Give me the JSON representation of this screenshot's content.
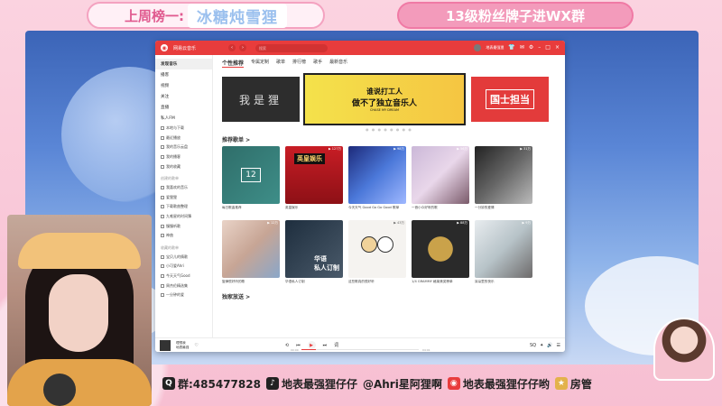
{
  "overlay": {
    "weekly_label": "上周榜一:",
    "weekly_name": "冰糖炖雪狸",
    "fan_group": "13级粉丝牌子进WX群",
    "qq_group": "群:485477828",
    "douyin": "地表最强狸仔仔",
    "weibo": "@Ahri星阿狸啊",
    "netease": "地表最强狸仔仔哟",
    "manager": "房管"
  },
  "app": {
    "title": "网易云音乐",
    "search_placeholder": "搜索",
    "user": "地表最强狸",
    "sidebar": {
      "items": [
        "发现音乐",
        "播客",
        "视频",
        "关注",
        "直播",
        "私人FM"
      ],
      "my_group": [
        "本地与下载",
        "最近播放",
        "我的音乐云盘",
        "我的播客",
        "我的收藏"
      ],
      "created_label": "创建的歌单",
      "playlists": [
        "我喜欢的音乐",
        "爱狸狸",
        "下载歌曲整理",
        "九唯星的时间簿",
        "慢慢听歌",
        "神曲"
      ],
      "collected_label": "收藏的歌单",
      "collected": [
        "宝贝儿的情歌",
        "小可爱Ahri",
        "今天天气Good",
        "周杰伦精选集",
        "一分钟的爱"
      ]
    },
    "tabs": [
      "个性推荐",
      "专属定制",
      "歌单",
      "排行榜",
      "歌手",
      "最新音乐"
    ],
    "banners": {
      "left": "我是狸",
      "mid_line1": "谁说打工人",
      "mid_line2": "做不了独立音乐人",
      "mid_line3": "CHASE MY DREAM",
      "right": "国士担当"
    },
    "recommended_title": "推荐歌单 >",
    "exclusive_title": "独家放送 >",
    "cards": [
      {
        "caption": "每日歌曲推荐",
        "count": ""
      },
      {
        "caption": "英皇娱乐",
        "count": "▶ 127万"
      },
      {
        "caption": "今天天气 Good Go Go Good 歌单",
        "count": "▶ 98万"
      },
      {
        "caption": "一首小众好听的歌",
        "count": "▶ 56万"
      },
      {
        "caption": "一分钟的爱情",
        "count": "▶ 31万"
      },
      {
        "caption": "旋律很好听的歌",
        "count": "▶ 12万"
      },
      {
        "caption": "华语私人订制",
        "count": ""
      },
      {
        "caption": "这些歌真的很好听",
        "count": "▶ 43万"
      },
      {
        "caption": "1/4 GRAMMY 格莱美奖榜单",
        "count": "▶ 88万"
      },
      {
        "caption": "耳朵里的快乐",
        "count": "▶ 9万"
      }
    ],
    "card_overlays": {
      "card2": "英皇娱乐",
      "card7": "华语\n私人订制"
    },
    "player": {
      "song": "理想我",
      "artist": "地表最强",
      "time_now": "00:00",
      "time_total": "04:01"
    },
    "progress": 0.12
  }
}
